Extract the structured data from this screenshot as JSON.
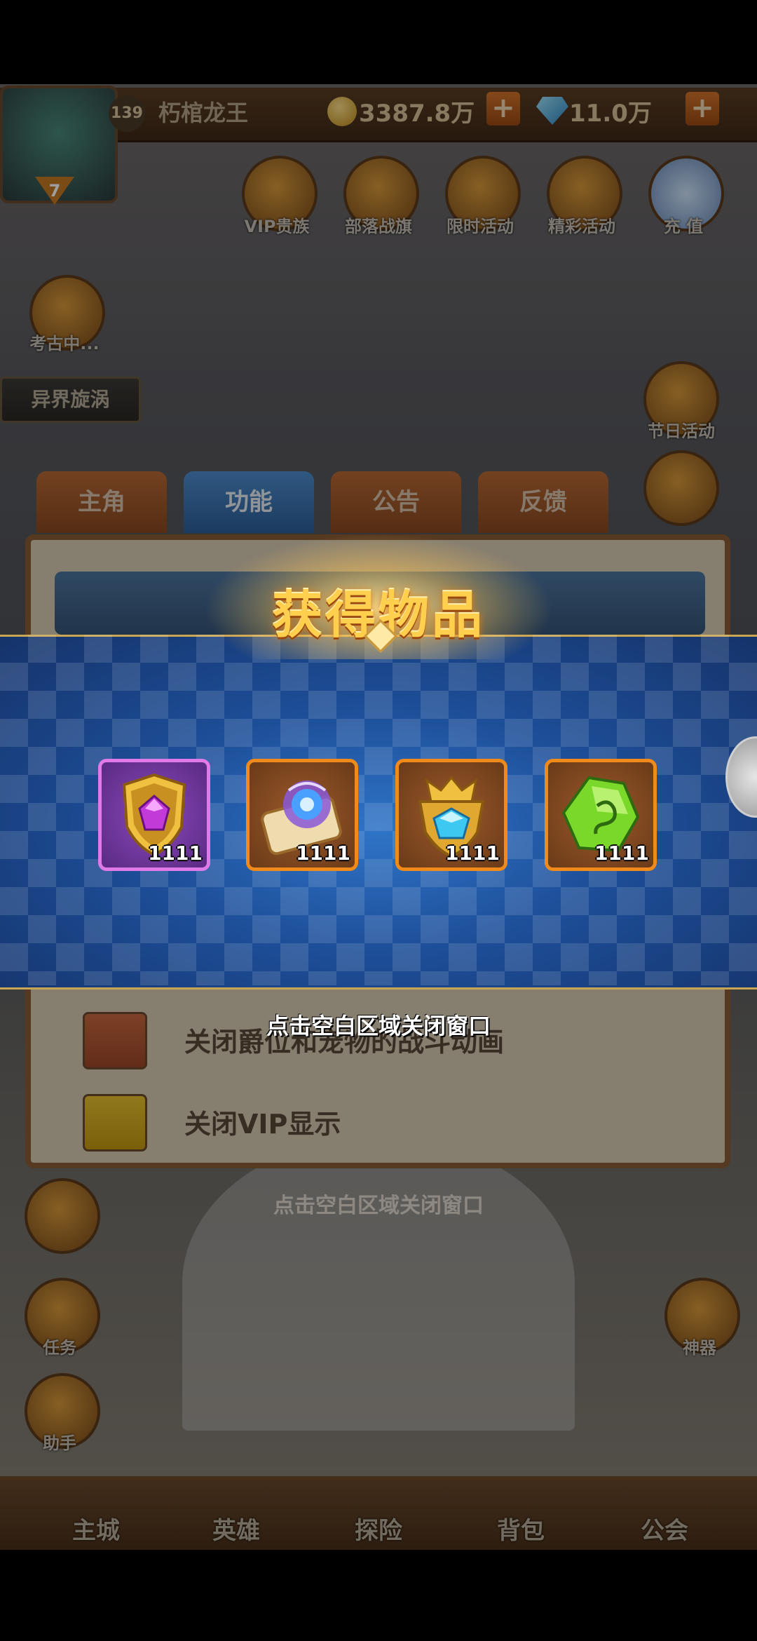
{
  "player": {
    "level": "139",
    "name": "朽棺龙王",
    "avatar_level": "7",
    "coins": "3387.8万",
    "gems": "11.0万"
  },
  "top_icons": [
    {
      "label": "VIP贵族"
    },
    {
      "label": "部落战旗"
    },
    {
      "label": "限时活动"
    },
    {
      "label": "精彩活动"
    },
    {
      "label": "充 值"
    }
  ],
  "left_icons": {
    "archaeology": "考古中...",
    "portal": "异界旋涡"
  },
  "right_icons": {
    "festival": "节日活动",
    "artifact": "神器"
  },
  "left_bottom_icons": {
    "task": "任务",
    "helper": "助手"
  },
  "settings": {
    "tabs": [
      "主角",
      "功能",
      "公告",
      "反馈"
    ],
    "active_tab": "功能",
    "options": [
      {
        "label": "关闭爵位和宠物的战斗动画"
      },
      {
        "label": "关闭VIP显示"
      }
    ],
    "close_hint": "点击空白区域关闭窗口"
  },
  "reward_modal": {
    "title": "获得物品",
    "items": [
      {
        "icon": "purple-gem-shield-icon",
        "quantity": "1111",
        "rarity": "purple"
      },
      {
        "icon": "magic-scroll-icon",
        "quantity": "1111",
        "rarity": "orange"
      },
      {
        "icon": "gold-crest-badge-icon",
        "quantity": "1111",
        "rarity": "orange"
      },
      {
        "icon": "green-rune-stone-icon",
        "quantity": "1111",
        "rarity": "orange"
      }
    ],
    "close_hint": "点击空白区域关闭窗口"
  },
  "bottom_nav": [
    "主城",
    "英雄",
    "探险",
    "背包",
    "公会"
  ],
  "colors": {
    "modal_blue": "#1d4e98",
    "title_gold": "#ffcf4d",
    "purple_frame": "#e07ae8",
    "orange_frame": "#f08a1a"
  }
}
